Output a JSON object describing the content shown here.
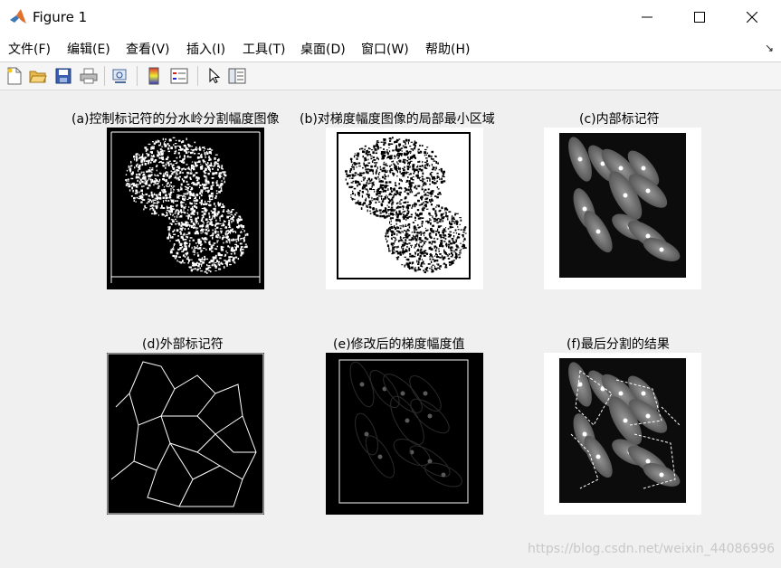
{
  "window": {
    "title": "Figure 1",
    "icon": "matlab-icon"
  },
  "menu": {
    "items": [
      "文件(F)",
      "编辑(E)",
      "查看(V)",
      "插入(I)",
      "工具(T)",
      "桌面(D)",
      "窗口(W)",
      "帮助(H)"
    ]
  },
  "toolbar": {
    "icons": [
      "new-figure-icon",
      "open-file-icon",
      "save-icon",
      "print-icon",
      "link-plot-icon",
      "insert-colorbar-icon",
      "insert-legend-icon",
      "edit-plot-icon",
      "property-inspector-icon"
    ]
  },
  "panels": [
    {
      "title": "(a)控制标记符的分水岭分割幅度图像"
    },
    {
      "title": "(b)对梯度幅度图像的局部最小区域"
    },
    {
      "title": "(c)内部标记符"
    },
    {
      "title": "(d)外部标记符"
    },
    {
      "title": "(e)修改后的梯度幅度值"
    },
    {
      "title": "(f)最后分割的结果"
    }
  ],
  "watermark": "https://blog.csdn.net/weixin_44086996"
}
